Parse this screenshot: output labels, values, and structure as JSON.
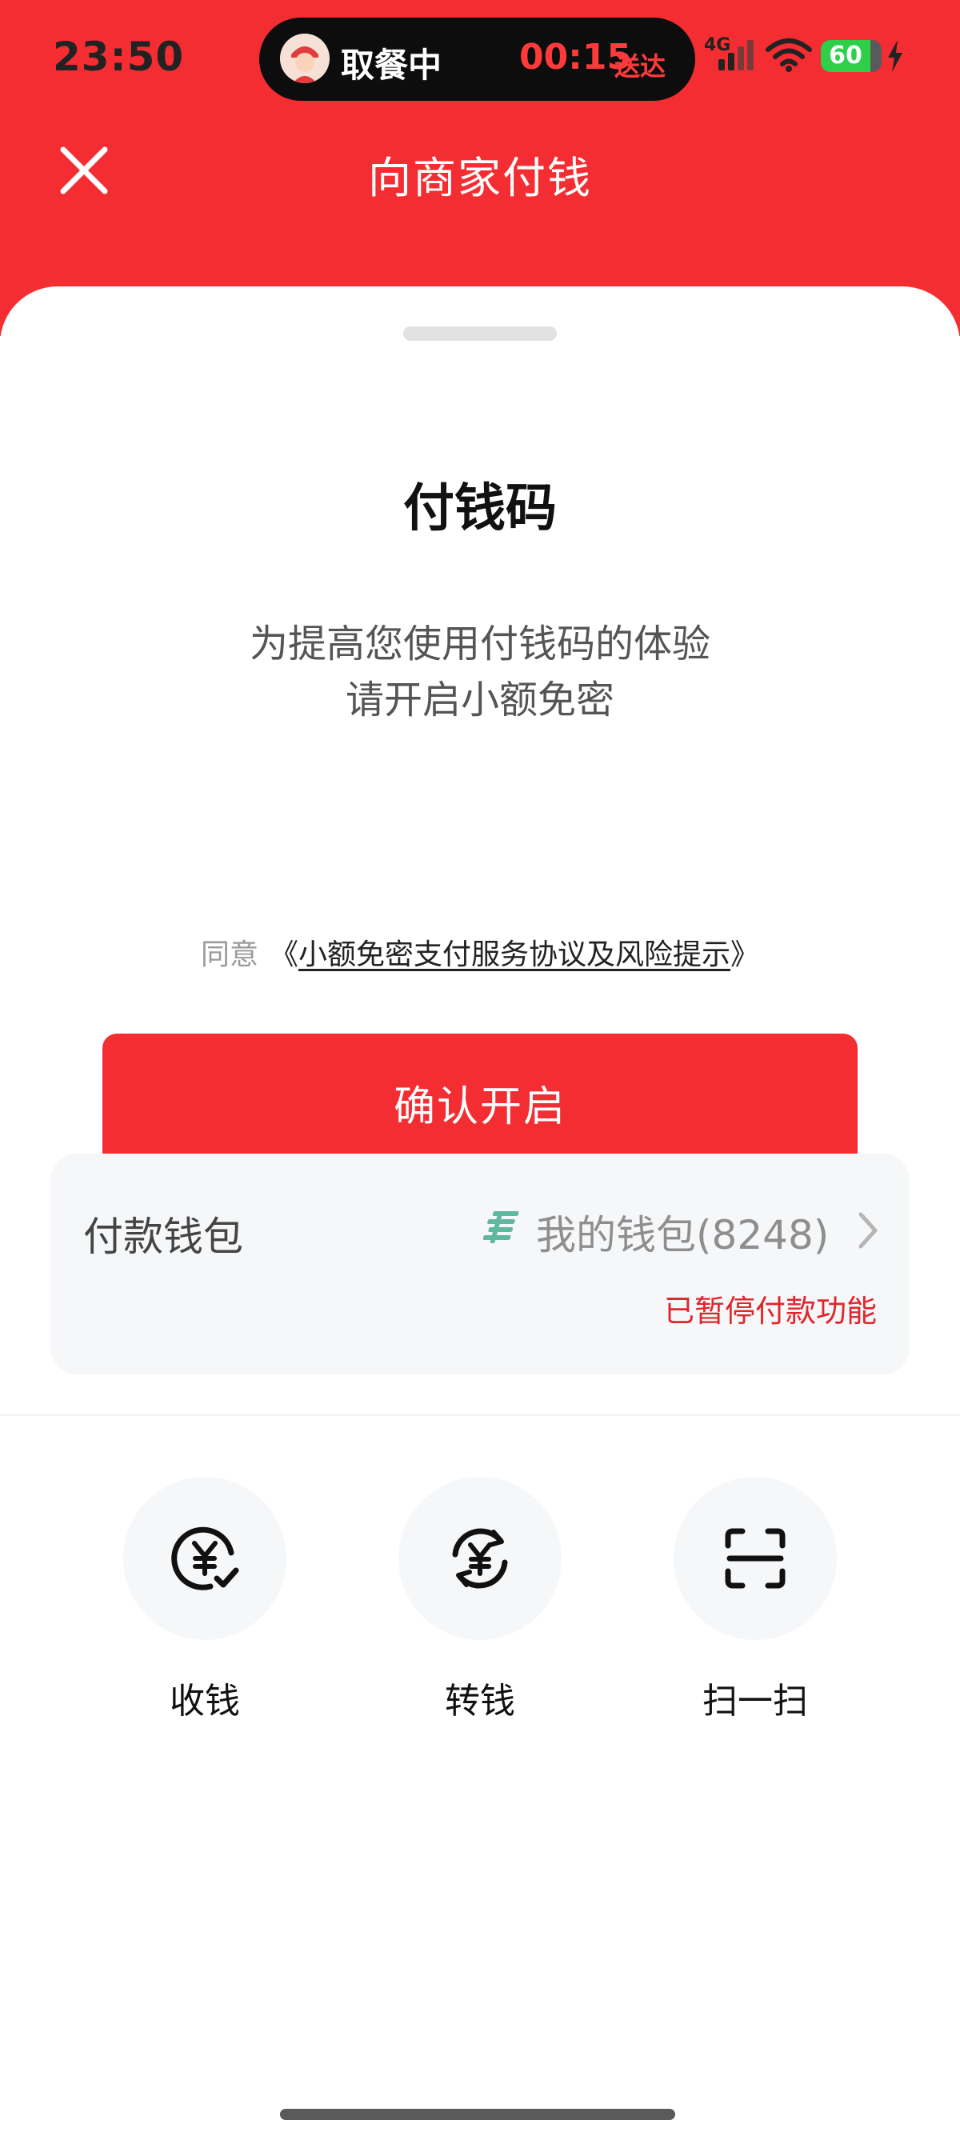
{
  "status_bar": {
    "time": "23:50",
    "network": "4G",
    "battery": "60",
    "battery_level": 0.6
  },
  "live_activity": {
    "label": "取餐中",
    "timer": "00:15",
    "timer_label": "送达"
  },
  "nav": {
    "title": "向商家付钱"
  },
  "sheet": {
    "title": "付钱码",
    "desc_line1": "为提高您使用付钱码的体验",
    "desc_line2": "请开启小额免密",
    "agree_prefix": "同意",
    "agree_link_open": "《",
    "agree_link_text": "小额免密支付服务协议及风险提示",
    "agree_link_close": "》",
    "confirm_label": "确认开启"
  },
  "wallet": {
    "label": "付款钱包",
    "name": "我的钱包(8248)",
    "status": "已暂停付款功能"
  },
  "actions": [
    {
      "label": "收钱",
      "icon": "receive-yuan-icon"
    },
    {
      "label": "转钱",
      "icon": "transfer-yuan-icon"
    },
    {
      "label": "扫一扫",
      "icon": "scan-icon"
    }
  ],
  "colors": {
    "brand_red": "#f42d33",
    "warning_red": "#e0262c",
    "card_bg": "#f6f7f9"
  }
}
